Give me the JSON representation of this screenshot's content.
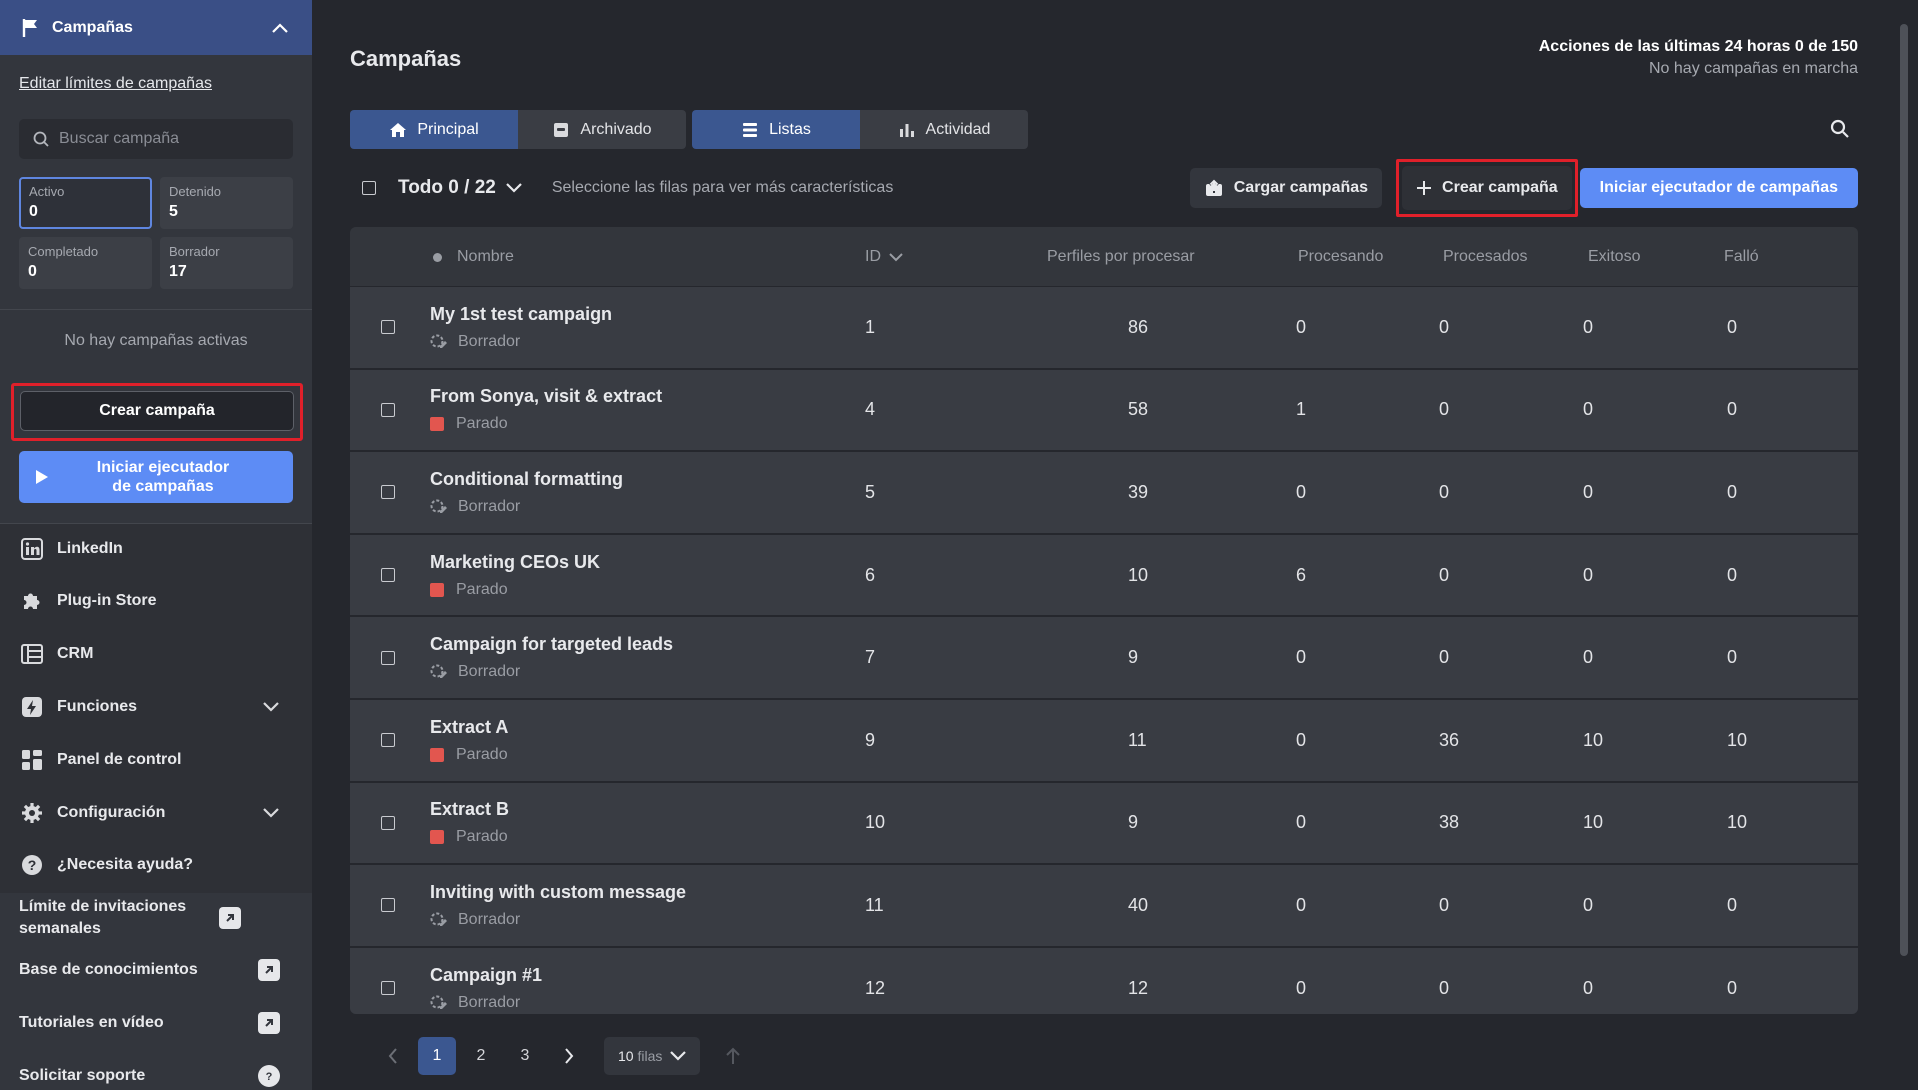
{
  "sidebar": {
    "header": "Campañas",
    "edit_limits": "Editar límites de campañas",
    "search_placeholder": "Buscar campaña",
    "stats": [
      {
        "label": "Activo",
        "value": "0"
      },
      {
        "label": "Detenido",
        "value": "5"
      },
      {
        "label": "Completado",
        "value": "0"
      },
      {
        "label": "Borrador",
        "value": "17"
      }
    ],
    "no_active": "No hay campañas activas",
    "create_btn": "Crear campaña",
    "run_btn_l1": "Iniciar ejecutador",
    "run_btn_l2": "de campañas",
    "nav": [
      {
        "label": "LinkedIn",
        "icon": "linkedin-icon"
      },
      {
        "label": "Plug-in Store",
        "icon": "puzzle-icon"
      },
      {
        "label": "CRM",
        "icon": "crm-icon"
      },
      {
        "label": "Funciones",
        "icon": "bolt-icon"
      },
      {
        "label": "Panel de control",
        "icon": "dashboard-icon"
      },
      {
        "label": "Configuración",
        "icon": "gear-icon"
      },
      {
        "label": "¿Necesita ayuda?",
        "icon": "help-icon"
      }
    ],
    "bottom": [
      {
        "label": "Límite de invitaciones semanales"
      },
      {
        "label": "Base de conocimientos"
      },
      {
        "label": "Tutoriales en vídeo"
      },
      {
        "label": "Solicitar soporte"
      }
    ]
  },
  "main": {
    "title": "Campañas",
    "actions_line": "Acciones de las últimas 24 horas 0 de 150",
    "status_line": "No hay campañas en marcha",
    "tabs": [
      "Principal",
      "Archivado",
      "Listas",
      "Actividad"
    ],
    "todo": "Todo 0 / 22",
    "hint": "Seleccione las filas para ver más características",
    "load_btn": "Cargar campañas",
    "create_btn": "Crear campaña",
    "run_btn": "Iniciar ejecutador de campañas",
    "columns": [
      "Nombre",
      "ID",
      "Perfiles por procesar",
      "Procesando",
      "Procesados",
      "Exitoso",
      "Falló"
    ],
    "rows": [
      {
        "name": "My 1st test campaign",
        "status": "Borrador",
        "id": "1",
        "profiles": "86",
        "processing": "0",
        "processed": "0",
        "success": "0",
        "failed": "0"
      },
      {
        "name": "From Sonya, visit & extract",
        "status": "Parado",
        "id": "4",
        "profiles": "58",
        "processing": "1",
        "processed": "0",
        "success": "0",
        "failed": "0"
      },
      {
        "name": "Conditional formatting",
        "status": "Borrador",
        "id": "5",
        "profiles": "39",
        "processing": "0",
        "processed": "0",
        "success": "0",
        "failed": "0"
      },
      {
        "name": "Marketing CEOs UK",
        "status": "Parado",
        "id": "6",
        "profiles": "10",
        "processing": "6",
        "processed": "0",
        "success": "0",
        "failed": "0"
      },
      {
        "name": "Campaign for targeted leads",
        "status": "Borrador",
        "id": "7",
        "profiles": "9",
        "processing": "0",
        "processed": "0",
        "success": "0",
        "failed": "0"
      },
      {
        "name": "Extract A",
        "status": "Parado",
        "id": "9",
        "profiles": "11",
        "processing": "0",
        "processed": "36",
        "success": "10",
        "failed": "10"
      },
      {
        "name": "Extract B",
        "status": "Parado",
        "id": "10",
        "profiles": "9",
        "processing": "0",
        "processed": "38",
        "success": "10",
        "failed": "10"
      },
      {
        "name": "Inviting with custom message",
        "status": "Borrador",
        "id": "11",
        "profiles": "40",
        "processing": "0",
        "processed": "0",
        "success": "0",
        "failed": "0"
      },
      {
        "name": "Campaign #1",
        "status": "Borrador",
        "id": "12",
        "profiles": "12",
        "processing": "0",
        "processed": "0",
        "success": "0",
        "failed": "0"
      }
    ],
    "pager": {
      "pages": [
        "1",
        "2",
        "3"
      ],
      "rows_value": "10",
      "rows_unit": "filas"
    }
  },
  "colors": {
    "accent": "#5d8cf5",
    "selected_tab": "#3b5790",
    "highlight": "#e0202a",
    "stopped": "#e2564f"
  }
}
